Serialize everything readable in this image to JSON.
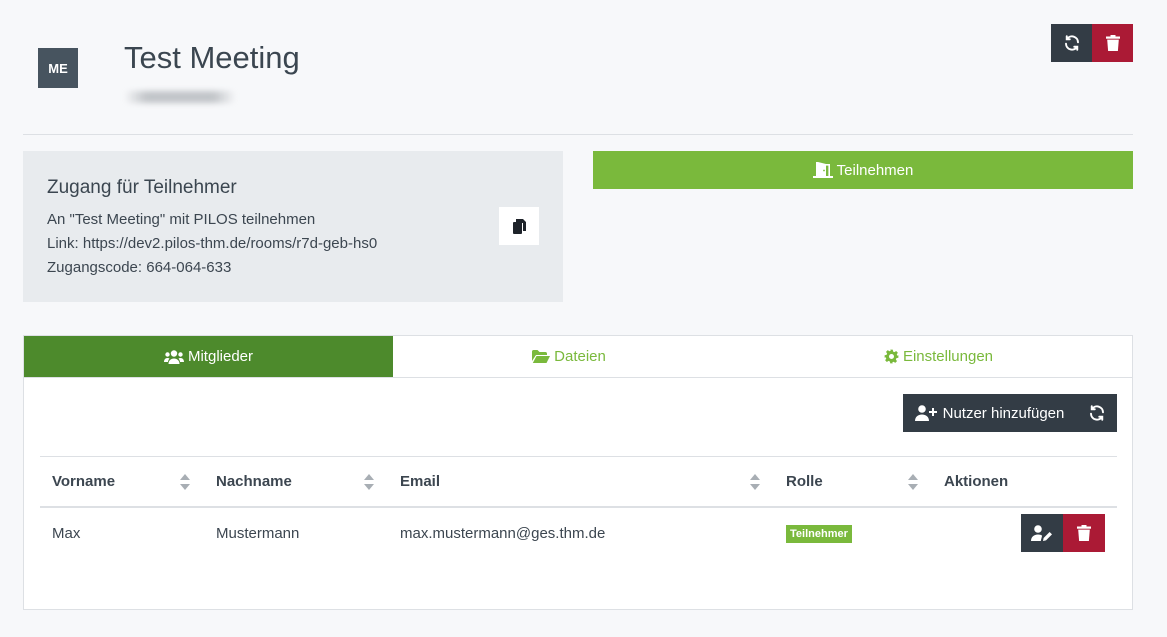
{
  "header": {
    "avatar_initials": "ME",
    "title": "Test Meeting",
    "reload_icon": "sync-icon",
    "delete_icon": "trash-icon"
  },
  "access": {
    "heading": "Zugang für Teilnehmer",
    "invite_line": "An \"Test Meeting\" mit PILOS teilnehmen",
    "link_line": "Link: https://dev2.pilos-thm.de/rooms/r7d-geb-hs0",
    "code_line": "Zugangscode: 664-064-633",
    "copy_icon": "copy-icon"
  },
  "join": {
    "label": "Teilnehmen",
    "icon": "door-open-icon"
  },
  "tabs": [
    {
      "label": "Mitglieder",
      "icon": "users-icon",
      "active": true
    },
    {
      "label": "Dateien",
      "icon": "folder-open-icon",
      "active": false
    },
    {
      "label": "Einstellungen",
      "icon": "cog-icon",
      "active": false
    }
  ],
  "members": {
    "add_label": "Nutzer hinzufügen",
    "columns": [
      "Vorname",
      "Nachname",
      "Email",
      "Rolle",
      "Aktionen"
    ],
    "rows": [
      {
        "first": "Max",
        "last": "Mustermann",
        "email": "max.mustermann@ges.thm.de",
        "role": "Teilnehmer"
      }
    ]
  },
  "colors": {
    "accent_green": "#7ab93c",
    "active_tab": "#4d8a2c",
    "dark": "#333c45",
    "danger": "#ab1a35"
  }
}
